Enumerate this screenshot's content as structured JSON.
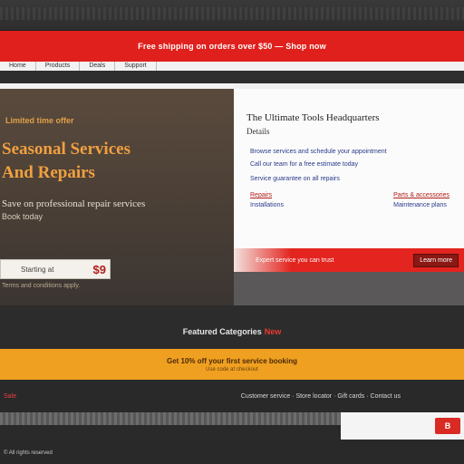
{
  "promo_bar": {
    "text": "Free shipping on orders over $50 — Shop now"
  },
  "nav": {
    "items": [
      "Home",
      "Products",
      "Deals",
      "Support"
    ]
  },
  "hero": {
    "eyebrow": "Limited time offer",
    "headline_1": "Seasonal Services",
    "headline_2": "And Repairs",
    "subline": "Save on professional repair services",
    "subline_2": "Book today",
    "price_label": "Starting at",
    "price_value": "$9",
    "fineprint": "Terms and conditions apply."
  },
  "info_card": {
    "title": "The Ultimate Tools Headquarters",
    "subtitle": "Details",
    "line_1": "Browse services and schedule your appointment",
    "line_2": "Call our team for a free estimate today",
    "line_3": "Service guarantee on all repairs",
    "col_left_1": "Repairs",
    "col_left_2": "Installations",
    "col_right_1": "Parts & accessories",
    "col_right_2": "Maintenance plans",
    "footer_text": "Expert service you can trust",
    "footer_button": "Learn more"
  },
  "mid_section": {
    "text": "Featured Categories",
    "accent": "New"
  },
  "orange_bar": {
    "main": "Get 10% off your first service booking",
    "sub": "Use code at checkout"
  },
  "footer_row": {
    "left": "Sale",
    "right": "Customer service · Store locator · Gift cards · Contact us"
  },
  "bottom": {
    "logo_text": "B",
    "fine_text": "© All rights reserved"
  },
  "colors": {
    "brand_red": "#e0201c",
    "accent_orange": "#f0a020",
    "hero_text": "#f0a040"
  }
}
